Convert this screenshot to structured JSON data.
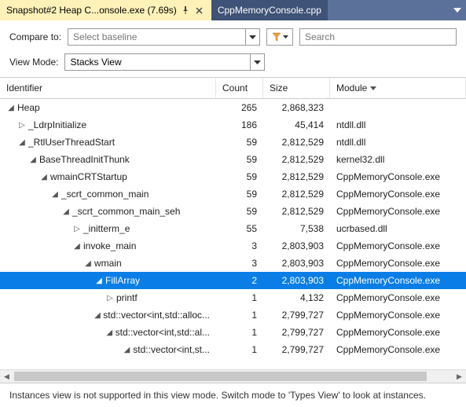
{
  "tabs": {
    "active": {
      "label": "Snapshot#2 Heap C...onsole.exe (7.69s)"
    },
    "inactive": {
      "label": "CppMemoryConsole.cpp"
    }
  },
  "toolbar": {
    "compare_label": "Compare to:",
    "compare_placeholder": "Select baseline",
    "search_placeholder": "Search",
    "viewmode_label": "View Mode:",
    "viewmode_value": "Stacks View"
  },
  "columns": {
    "identifier": "Identifier",
    "count": "Count",
    "size": "Size",
    "module": "Module"
  },
  "rows": [
    {
      "indent": 0,
      "exp": "expanded",
      "id": "Heap",
      "count": "265",
      "size": "2,868,323",
      "module": ""
    },
    {
      "indent": 1,
      "exp": "collapsed",
      "id": "_LdrpInitialize",
      "count": "186",
      "size": "45,414",
      "module": "ntdll.dll"
    },
    {
      "indent": 1,
      "exp": "expanded",
      "id": "_RtlUserThreadStart",
      "count": "59",
      "size": "2,812,529",
      "module": "ntdll.dll"
    },
    {
      "indent": 2,
      "exp": "expanded",
      "id": "BaseThreadInitThunk",
      "count": "59",
      "size": "2,812,529",
      "module": "kernel32.dll"
    },
    {
      "indent": 3,
      "exp": "expanded",
      "id": "wmainCRTStartup",
      "count": "59",
      "size": "2,812,529",
      "module": "CppMemoryConsole.exe"
    },
    {
      "indent": 4,
      "exp": "expanded",
      "id": "_scrt_common_main",
      "count": "59",
      "size": "2,812,529",
      "module": "CppMemoryConsole.exe"
    },
    {
      "indent": 5,
      "exp": "expanded",
      "id": "_scrt_common_main_seh",
      "count": "59",
      "size": "2,812,529",
      "module": "CppMemoryConsole.exe"
    },
    {
      "indent": 6,
      "exp": "collapsed",
      "id": "_initterm_e",
      "count": "55",
      "size": "7,538",
      "module": "ucrbased.dll"
    },
    {
      "indent": 6,
      "exp": "expanded",
      "id": "invoke_main",
      "count": "3",
      "size": "2,803,903",
      "module": "CppMemoryConsole.exe"
    },
    {
      "indent": 7,
      "exp": "expanded",
      "id": "wmain",
      "count": "3",
      "size": "2,803,903",
      "module": "CppMemoryConsole.exe"
    },
    {
      "indent": 8,
      "exp": "expanded",
      "id": "FillArray",
      "count": "2",
      "size": "2,803,903",
      "module": "CppMemoryConsole.exe",
      "selected": true
    },
    {
      "indent": 9,
      "exp": "collapsed",
      "id": "printf",
      "count": "1",
      "size": "4,132",
      "module": "CppMemoryConsole.exe"
    },
    {
      "indent": 9,
      "exp": "expanded",
      "id": "std::vector<int,std::alloc...",
      "count": "1",
      "size": "2,799,727",
      "module": "CppMemoryConsole.exe"
    },
    {
      "indent": 10,
      "exp": "expanded",
      "id": "std::vector<int,std::al...",
      "count": "1",
      "size": "2,799,727",
      "module": "CppMemoryConsole.exe"
    },
    {
      "indent": 11,
      "exp": "expanded",
      "id": "std::vector<int,st...",
      "count": "1",
      "size": "2,799,727",
      "module": "CppMemoryConsole.exe"
    }
  ],
  "status": "Instances view is not supported in this view mode. Switch mode to 'Types View' to look at instances."
}
